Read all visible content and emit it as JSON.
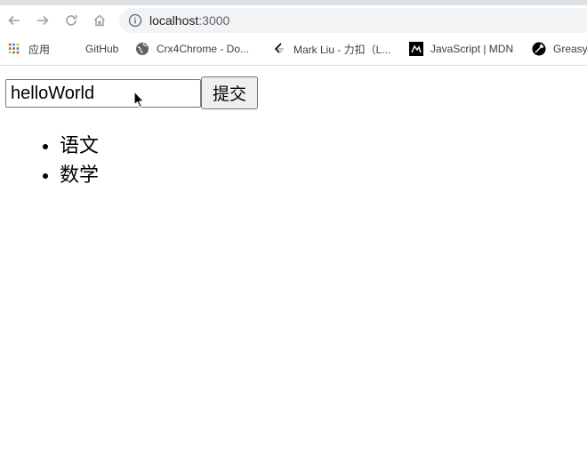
{
  "browser": {
    "url_host": "localhost",
    "url_port": ":3000",
    "bookmarks": [
      {
        "label": "应用",
        "icon": "apps-grid-icon"
      },
      {
        "label": "GitHub",
        "icon": "github-icon"
      },
      {
        "label": "Crx4Chrome - Do...",
        "icon": "globe-icon"
      },
      {
        "label": "Mark Liu - 力扣（L...",
        "icon": "leetcode-icon"
      },
      {
        "label": "JavaScript | MDN",
        "icon": "mdn-icon"
      },
      {
        "label": "Greasy",
        "icon": "greasyfork-icon"
      }
    ]
  },
  "app": {
    "input_value": "helloWorld",
    "submit_label": "提交",
    "items": [
      "语文",
      "数学"
    ]
  }
}
